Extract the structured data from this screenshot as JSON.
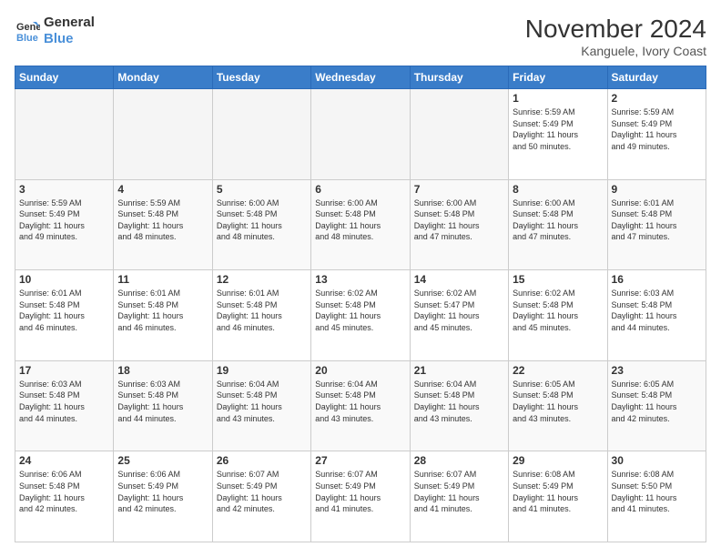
{
  "logo": {
    "line1": "General",
    "line2": "Blue"
  },
  "header": {
    "month": "November 2024",
    "location": "Kanguele, Ivory Coast"
  },
  "weekdays": [
    "Sunday",
    "Monday",
    "Tuesday",
    "Wednesday",
    "Thursday",
    "Friday",
    "Saturday"
  ],
  "weeks": [
    [
      {
        "day": "",
        "info": ""
      },
      {
        "day": "",
        "info": ""
      },
      {
        "day": "",
        "info": ""
      },
      {
        "day": "",
        "info": ""
      },
      {
        "day": "",
        "info": ""
      },
      {
        "day": "1",
        "info": "Sunrise: 5:59 AM\nSunset: 5:49 PM\nDaylight: 11 hours\nand 50 minutes."
      },
      {
        "day": "2",
        "info": "Sunrise: 5:59 AM\nSunset: 5:49 PM\nDaylight: 11 hours\nand 49 minutes."
      }
    ],
    [
      {
        "day": "3",
        "info": "Sunrise: 5:59 AM\nSunset: 5:49 PM\nDaylight: 11 hours\nand 49 minutes."
      },
      {
        "day": "4",
        "info": "Sunrise: 5:59 AM\nSunset: 5:48 PM\nDaylight: 11 hours\nand 48 minutes."
      },
      {
        "day": "5",
        "info": "Sunrise: 6:00 AM\nSunset: 5:48 PM\nDaylight: 11 hours\nand 48 minutes."
      },
      {
        "day": "6",
        "info": "Sunrise: 6:00 AM\nSunset: 5:48 PM\nDaylight: 11 hours\nand 48 minutes."
      },
      {
        "day": "7",
        "info": "Sunrise: 6:00 AM\nSunset: 5:48 PM\nDaylight: 11 hours\nand 47 minutes."
      },
      {
        "day": "8",
        "info": "Sunrise: 6:00 AM\nSunset: 5:48 PM\nDaylight: 11 hours\nand 47 minutes."
      },
      {
        "day": "9",
        "info": "Sunrise: 6:01 AM\nSunset: 5:48 PM\nDaylight: 11 hours\nand 47 minutes."
      }
    ],
    [
      {
        "day": "10",
        "info": "Sunrise: 6:01 AM\nSunset: 5:48 PM\nDaylight: 11 hours\nand 46 minutes."
      },
      {
        "day": "11",
        "info": "Sunrise: 6:01 AM\nSunset: 5:48 PM\nDaylight: 11 hours\nand 46 minutes."
      },
      {
        "day": "12",
        "info": "Sunrise: 6:01 AM\nSunset: 5:48 PM\nDaylight: 11 hours\nand 46 minutes."
      },
      {
        "day": "13",
        "info": "Sunrise: 6:02 AM\nSunset: 5:48 PM\nDaylight: 11 hours\nand 45 minutes."
      },
      {
        "day": "14",
        "info": "Sunrise: 6:02 AM\nSunset: 5:47 PM\nDaylight: 11 hours\nand 45 minutes."
      },
      {
        "day": "15",
        "info": "Sunrise: 6:02 AM\nSunset: 5:48 PM\nDaylight: 11 hours\nand 45 minutes."
      },
      {
        "day": "16",
        "info": "Sunrise: 6:03 AM\nSunset: 5:48 PM\nDaylight: 11 hours\nand 44 minutes."
      }
    ],
    [
      {
        "day": "17",
        "info": "Sunrise: 6:03 AM\nSunset: 5:48 PM\nDaylight: 11 hours\nand 44 minutes."
      },
      {
        "day": "18",
        "info": "Sunrise: 6:03 AM\nSunset: 5:48 PM\nDaylight: 11 hours\nand 44 minutes."
      },
      {
        "day": "19",
        "info": "Sunrise: 6:04 AM\nSunset: 5:48 PM\nDaylight: 11 hours\nand 43 minutes."
      },
      {
        "day": "20",
        "info": "Sunrise: 6:04 AM\nSunset: 5:48 PM\nDaylight: 11 hours\nand 43 minutes."
      },
      {
        "day": "21",
        "info": "Sunrise: 6:04 AM\nSunset: 5:48 PM\nDaylight: 11 hours\nand 43 minutes."
      },
      {
        "day": "22",
        "info": "Sunrise: 6:05 AM\nSunset: 5:48 PM\nDaylight: 11 hours\nand 43 minutes."
      },
      {
        "day": "23",
        "info": "Sunrise: 6:05 AM\nSunset: 5:48 PM\nDaylight: 11 hours\nand 42 minutes."
      }
    ],
    [
      {
        "day": "24",
        "info": "Sunrise: 6:06 AM\nSunset: 5:48 PM\nDaylight: 11 hours\nand 42 minutes."
      },
      {
        "day": "25",
        "info": "Sunrise: 6:06 AM\nSunset: 5:49 PM\nDaylight: 11 hours\nand 42 minutes."
      },
      {
        "day": "26",
        "info": "Sunrise: 6:07 AM\nSunset: 5:49 PM\nDaylight: 11 hours\nand 42 minutes."
      },
      {
        "day": "27",
        "info": "Sunrise: 6:07 AM\nSunset: 5:49 PM\nDaylight: 11 hours\nand 41 minutes."
      },
      {
        "day": "28",
        "info": "Sunrise: 6:07 AM\nSunset: 5:49 PM\nDaylight: 11 hours\nand 41 minutes."
      },
      {
        "day": "29",
        "info": "Sunrise: 6:08 AM\nSunset: 5:49 PM\nDaylight: 11 hours\nand 41 minutes."
      },
      {
        "day": "30",
        "info": "Sunrise: 6:08 AM\nSunset: 5:50 PM\nDaylight: 11 hours\nand 41 minutes."
      }
    ]
  ]
}
